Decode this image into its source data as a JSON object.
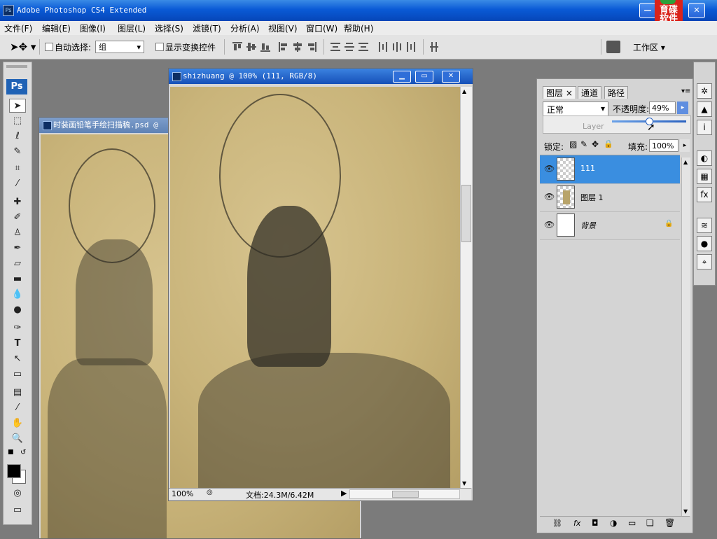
{
  "app": {
    "title": "Adobe Photoshop CS4 Extended",
    "logo_text": "育碟软件"
  },
  "menu": [
    "文件(F)",
    "编辑(E)",
    "图像(I)",
    "图层(L)",
    "选择(S)",
    "滤镜(T)",
    "分析(A)",
    "视图(V)",
    "窗口(W)",
    "帮助(H)"
  ],
  "options_bar": {
    "auto_select_label": "自动选择:",
    "auto_select_value": "组",
    "show_transform_label": "显示变换控件",
    "workspace_label": "工作区"
  },
  "toolbox": {
    "logo": "Ps"
  },
  "documents": {
    "back": {
      "title": "时装画铅笔手绘扫描稿.psd @"
    },
    "front": {
      "title": "shizhuang @ 100% (111, RGB/8)",
      "zoom": "100%",
      "doc_info": "文档:24.3M/6.42M"
    }
  },
  "layers_panel": {
    "tabs": [
      "图层",
      "通道",
      "路径"
    ],
    "blend_mode": "正常",
    "opacity_label": "不透明度:",
    "opacity_value": "49%",
    "opacity_fraction": 0.49,
    "slider_caption": "Layer",
    "lock_label": "锁定:",
    "fill_label": "填充:",
    "fill_value": "100%",
    "layers": [
      {
        "name": "111",
        "selected": true,
        "thumb": "transparent"
      },
      {
        "name": "图层 1",
        "selected": false,
        "thumb": "figure"
      },
      {
        "name": "背景",
        "selected": false,
        "thumb": "white",
        "locked": true
      }
    ]
  }
}
